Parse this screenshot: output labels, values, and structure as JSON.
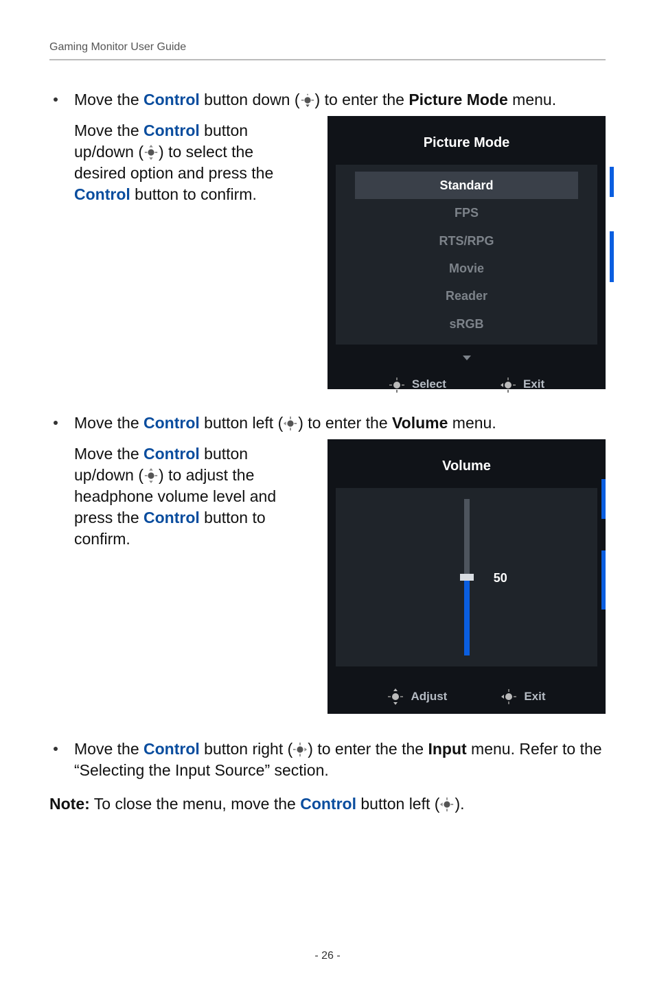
{
  "header": {
    "title": "Gaming Monitor User Guide"
  },
  "bullets": {
    "b1_a": "Move the ",
    "b1_b": " button down (",
    "b1_c": ") to enter the ",
    "b1_d": " menu.",
    "b1_term_ctrl": "Control",
    "b1_term_pm": "Picture Mode",
    "b1_sub_a": "Move the ",
    "b1_sub_b": " button up/down (",
    "b1_sub_c": ") to select the desired option and press the ",
    "b1_sub_d": " button to confirm.",
    "b2_a": "Move the ",
    "b2_b": " button left (",
    "b2_c": ") to enter the ",
    "b2_d": " menu.",
    "b2_term_vol": "Volume",
    "b2_sub_a": "Move the ",
    "b2_sub_b": " button up/down (",
    "b2_sub_c": ") to adjust the headphone volume level and press the ",
    "b2_sub_d": " button to confirm.",
    "b3_a": "Move the ",
    "b3_b": " button right (",
    "b3_c": ") to enter the the ",
    "b3_d": " menu. Refer to the “Selecting the Input Source” section.",
    "b3_term_input": "Input"
  },
  "note": {
    "label": "Note:",
    "a": " To close the menu, move the ",
    "b": " button left (",
    "c": ")."
  },
  "osd_pm": {
    "title": "Picture Mode",
    "items": [
      "Standard",
      "FPS",
      "RTS/RPG",
      "Movie",
      "Reader",
      "sRGB"
    ],
    "footer_left": "Select",
    "footer_right": "Exit"
  },
  "osd_vol": {
    "title": "Volume",
    "value": "50",
    "footer_left": "Adjust",
    "footer_right": "Exit"
  },
  "page_number": "- 26 -"
}
